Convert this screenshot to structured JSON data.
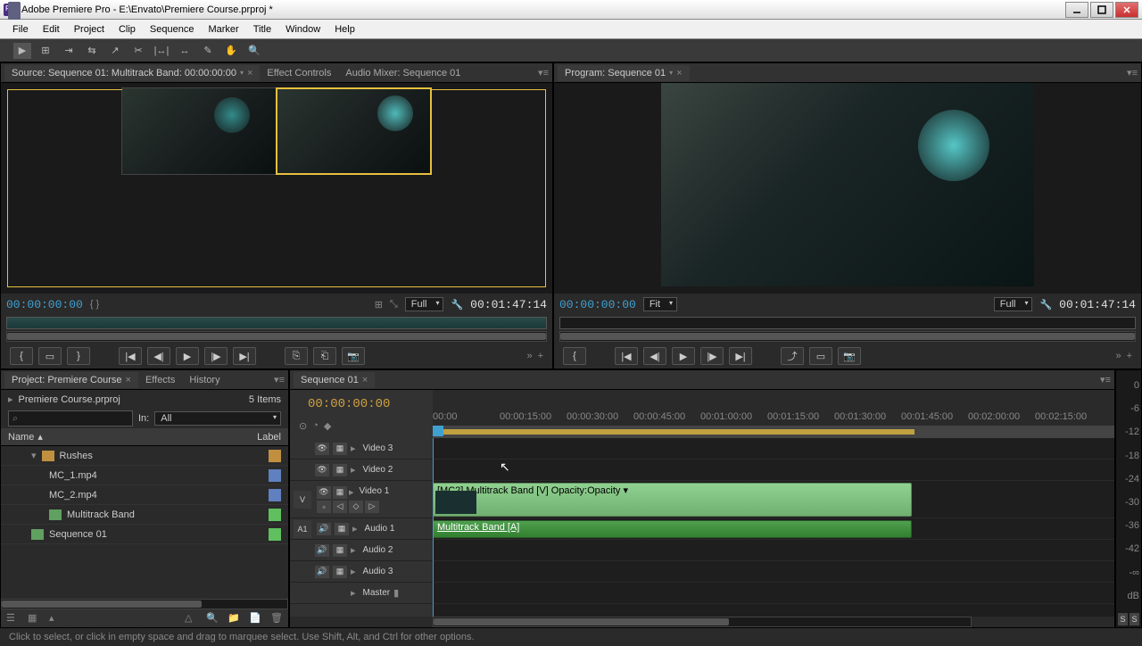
{
  "titlebar": {
    "text": "Adobe Premiere Pro - E:\\Envato\\Premiere Course.prproj *"
  },
  "menubar": {
    "items": [
      "File",
      "Edit",
      "Project",
      "Clip",
      "Sequence",
      "Marker",
      "Title",
      "Window",
      "Help"
    ]
  },
  "source_panel": {
    "tabs": {
      "source": "Source: Sequence 01: Multitrack Band: 00:00:00:00",
      "effect_controls": "Effect Controls",
      "audio_mixer": "Audio Mixer: Sequence 01"
    },
    "timecode_in": "00:00:00:00",
    "timecode_out": "00:01:47:14",
    "fit_label": "Full"
  },
  "program_panel": {
    "tab": "Program: Sequence 01",
    "timecode_in": "00:00:00:00",
    "timecode_out": "00:01:47:14",
    "fit_label": "Fit",
    "full_label": "Full"
  },
  "project_panel": {
    "tabs": {
      "project": "Project: Premiere Course",
      "effects": "Effects",
      "history": "History"
    },
    "filename": "Premiere Course.prproj",
    "item_count": "5 Items",
    "search_icon": "⌕",
    "in_label": "In:",
    "in_value": "All",
    "columns": {
      "name": "Name",
      "label": "Label"
    },
    "items": [
      {
        "name": "Rushes",
        "type": "folder",
        "label_color": "#c09040"
      },
      {
        "name": "MC_1.mp4",
        "type": "clip",
        "label_color": "#6080c0"
      },
      {
        "name": "MC_2.mp4",
        "type": "clip",
        "label_color": "#6080c0"
      },
      {
        "name": "Multitrack Band",
        "type": "multi",
        "label_color": "#60c060"
      },
      {
        "name": "Sequence 01",
        "type": "seq",
        "label_color": "#60c060"
      }
    ]
  },
  "timeline": {
    "tab": "Sequence 01",
    "playhead_tc": "00:00:00:00",
    "ruler_ticks": [
      "00:00",
      "00:00:15:00",
      "00:00:30:00",
      "00:00:45:00",
      "00:01:00:00",
      "00:01:15:00",
      "00:01:30:00",
      "00:01:45:00",
      "00:02:00:00",
      "00:02:15:00"
    ],
    "tracks": {
      "video3": "Video 3",
      "video2": "Video 2",
      "video1": "Video 1",
      "audio1": "Audio 1",
      "audio2": "Audio 2",
      "audio3": "Audio 3",
      "master": "Master"
    },
    "v_label": "V",
    "a1_label": "A1",
    "clip_video1": "[MC2] Multitrack Band [V]  Opacity:Opacity ▾",
    "clip_audio1": "Multitrack Band [A]"
  },
  "meter": {
    "ticks": [
      "0",
      "-6",
      "-12",
      "-18",
      "-24",
      "-30",
      "-36",
      "-42",
      "-∞",
      "dB"
    ]
  },
  "statusbar": {
    "text": "Click to select, or click in empty space and drag to marquee select. Use Shift, Alt, and Ctrl for other options."
  }
}
